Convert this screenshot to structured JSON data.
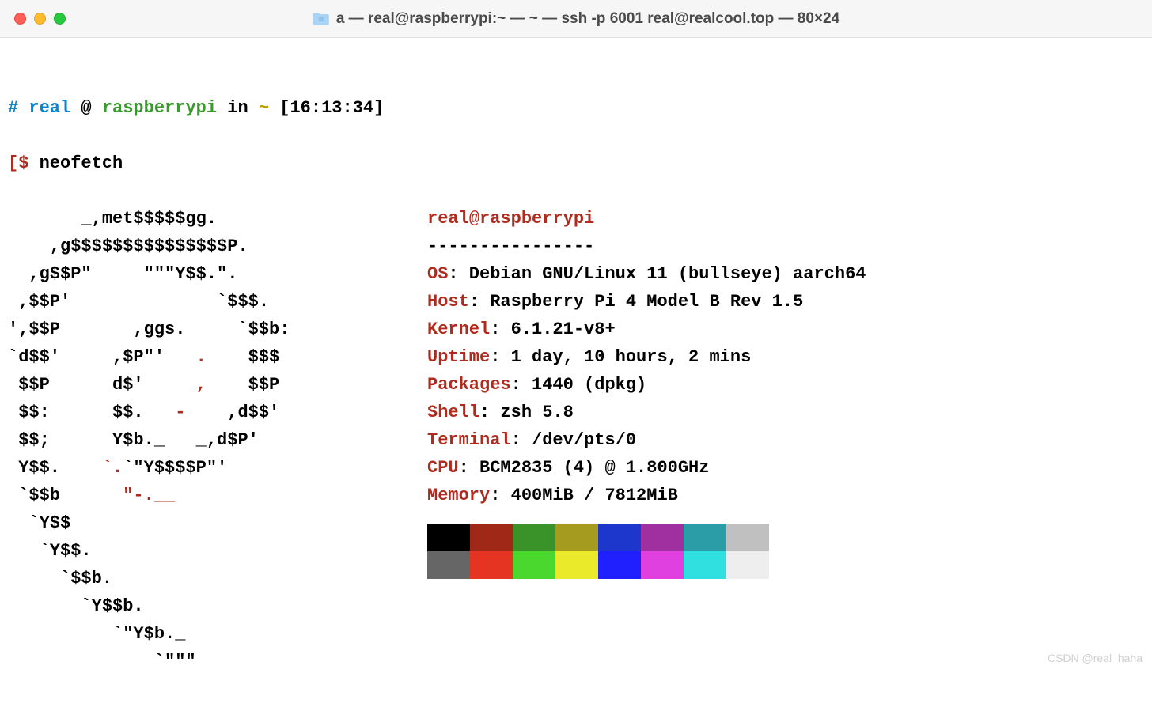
{
  "titlebar": {
    "title": "a — real@raspberrypi:~ — ~ — ssh -p 6001 real@realcool.top — 80×24"
  },
  "prompt": {
    "hash": "#",
    "user": "real",
    "at": "@",
    "host": "raspberrypi",
    "in": "in",
    "path": "~",
    "time": "[16:13:34]",
    "dollar": "$",
    "command": "neofetch"
  },
  "ascii": {
    "l01": "       _,met$$$$$gg.",
    "l02": "    ,g$$$$$$$$$$$$$$$P.",
    "l03": "  ,g$$P\"     \"\"\"Y$$.\".",
    "l04": " ,$$P'              `$$$.",
    "l05a": "',$$P       ,ggs.     `$$b:",
    "l06a": "`d$$'     ,$P\"'   ",
    "l06b": ".",
    "l06c": "    $$$",
    "l07a": " $$P      d$'     ",
    "l07b": ",",
    "l07c": "    $$P",
    "l08a": " $$:      $$.   ",
    "l08b": "-",
    "l08c": "    ,d$$'",
    "l09": " $$;      Y$b._   _,d$P'",
    "l10a": " Y$$.    ",
    "l10b": "`.",
    "l10c": "`\"Y$$$$P\"'",
    "l11a": " `$$b      ",
    "l11b": "\"-.__",
    "l12": "  `Y$$",
    "l13": "   `Y$$.",
    "l14": "     `$$b.",
    "l15": "       `Y$$b.",
    "l16": "          `\"Y$b._",
    "l17": "              `\"\"\""
  },
  "info": {
    "user": "real",
    "at": "@",
    "host": "raspberrypi",
    "divider": "----------------",
    "os_label": "OS",
    "os_val": ": Debian GNU/Linux 11 (bullseye) aarch64",
    "host_label": "Host",
    "host_val": ": Raspberry Pi 4 Model B Rev 1.5",
    "kernel_label": "Kernel",
    "kernel_val": ": 6.1.21-v8+",
    "uptime_label": "Uptime",
    "uptime_val": ": 1 day, 10 hours, 2 mins",
    "packages_label": "Packages",
    "packages_val": ": 1440 (dpkg)",
    "shell_label": "Shell",
    "shell_val": ": zsh 5.8",
    "terminal_label": "Terminal",
    "terminal_val": ": /dev/pts/0",
    "cpu_label": "CPU",
    "cpu_val": ": BCM2835 (4) @ 1.800GHz",
    "memory_label": "Memory",
    "memory_val": ": 400MiB / 7812MiB"
  },
  "colors": {
    "row1": [
      "#000000",
      "#a02817",
      "#3a9328",
      "#a59b1e",
      "#1d36cc",
      "#a030a0",
      "#2a9da6",
      "#c0c0c0"
    ],
    "row2": [
      "#666666",
      "#e63422",
      "#4ad82e",
      "#eaea2a",
      "#2020ff",
      "#e040e0",
      "#30e0e0",
      "#eeeeee"
    ]
  },
  "watermark": "CSDN @real_haha"
}
